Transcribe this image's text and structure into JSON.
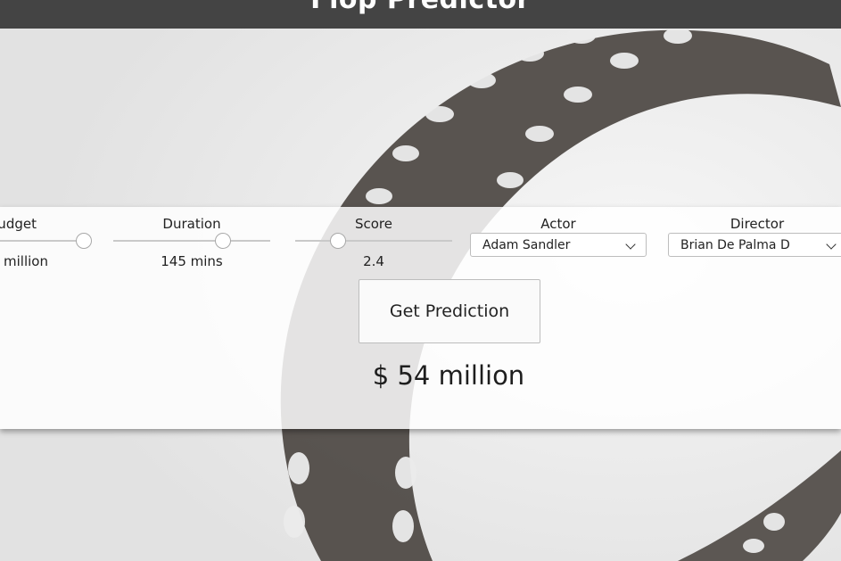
{
  "app": {
    "title": "Flop Predictor"
  },
  "form": {
    "budget": {
      "label": "Budget",
      "value_text": "million",
      "level": 1.0
    },
    "duration": {
      "label": "Duration",
      "value_text": "145 mins",
      "level": 0.7
    },
    "score": {
      "label": "Score",
      "value_text": "2.4",
      "level": 0.27
    },
    "actor": {
      "label": "Actor",
      "selected": "Adam Sandler"
    },
    "director": {
      "label": "Director",
      "selected": "Brian De Palma D"
    },
    "predict_button": "Get Prediction",
    "result": "$ 54 million"
  },
  "icons": {
    "select_arrow": "chevron-down-icon"
  },
  "colors": {
    "header": "#444444",
    "panel": "#ffffff",
    "film_strip": "#4a4540"
  }
}
